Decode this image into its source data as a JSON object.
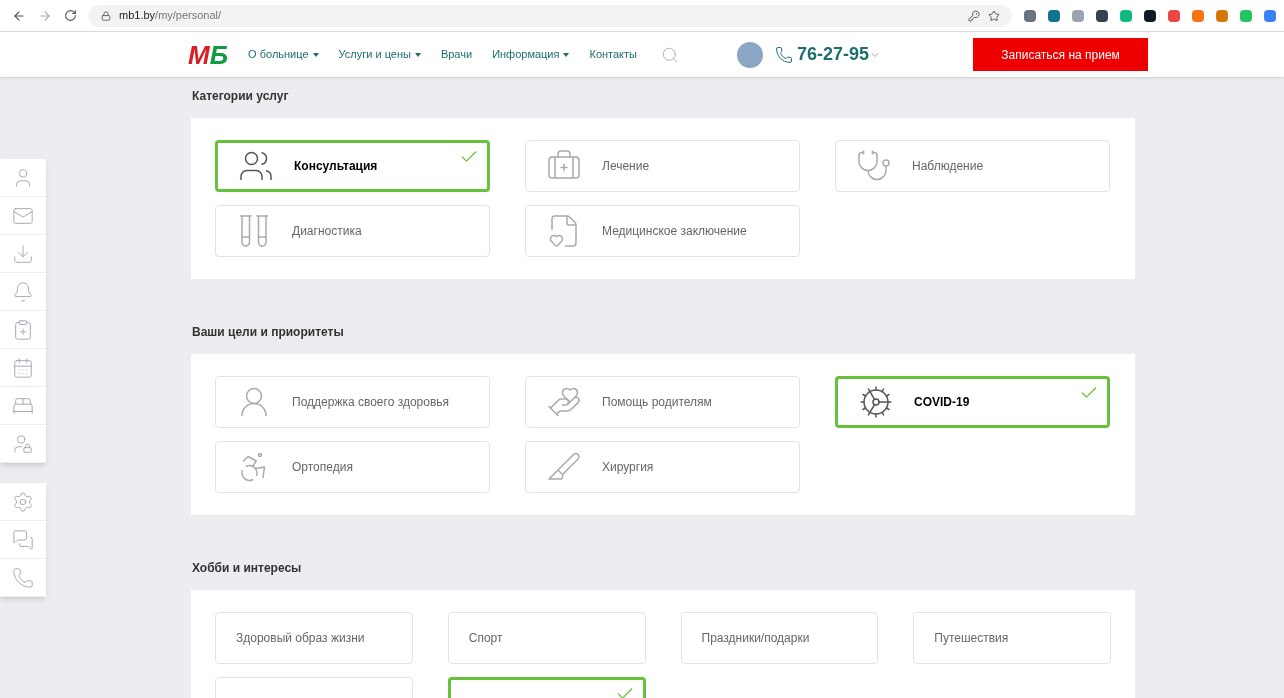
{
  "browser": {
    "url_host": "mb1.by",
    "url_path": "/my/personal/"
  },
  "header": {
    "logo": {
      "part_1": "М",
      "part_2": "Б"
    },
    "nav": [
      {
        "label": "О больнице",
        "has_menu": true
      },
      {
        "label": "Услуги и цены",
        "has_menu": true
      },
      {
        "label": "Врачи",
        "has_menu": false
      },
      {
        "label": "Информация",
        "has_menu": true
      },
      {
        "label": "Контакты",
        "has_menu": false
      }
    ],
    "phone": "76-27-95",
    "cta": "Записаться на прием"
  },
  "sections": [
    {
      "title": "Категории услуг",
      "items": [
        {
          "label": "Консультация",
          "selected": true
        },
        {
          "label": "Лечение",
          "selected": false
        },
        {
          "label": "Наблюдение",
          "selected": false
        },
        {
          "label": "Диагностика",
          "selected": false
        },
        {
          "label": "Медицинское заключение",
          "selected": false
        }
      ]
    },
    {
      "title": "Ваши цели и приоритеты",
      "items": [
        {
          "label": "Поддержка своего здоровья",
          "selected": false
        },
        {
          "label": "Помощь родителям",
          "selected": false
        },
        {
          "label": "COVID-19",
          "selected": true
        },
        {
          "label": "Ортопедия",
          "selected": false
        },
        {
          "label": "Хирургия",
          "selected": false
        }
      ]
    },
    {
      "title": "Хобби и интересы",
      "items": [
        {
          "label": "Здоровый образ жизни",
          "selected": false
        },
        {
          "label": "Спорт",
          "selected": false
        },
        {
          "label": "Праздники/подарки",
          "selected": false
        },
        {
          "label": "Путешествия",
          "selected": false
        },
        {
          "selected": false
        },
        {
          "selected": true
        }
      ]
    }
  ]
}
